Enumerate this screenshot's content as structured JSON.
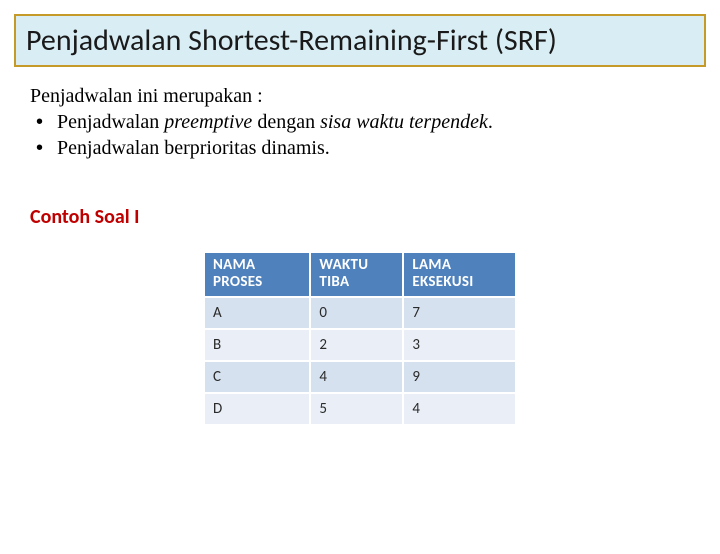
{
  "title": "Penjadwalan Shortest-Remaining-First (SRF)",
  "intro": {
    "lead": "Penjadwalan ini merupakan :",
    "bullets": [
      {
        "prefix": "Penjadwalan ",
        "italic": "preemptive",
        "mid": "  dengan ",
        "italic2": "sisa waktu terpendek",
        "suffix": "."
      },
      {
        "prefix": "Penjadwalan  berprioritas dinamis.",
        "italic": "",
        "mid": "",
        "italic2": "",
        "suffix": ""
      }
    ]
  },
  "subhead": "Contoh Soal I",
  "chart_data": {
    "type": "table",
    "title": "Contoh Soal I",
    "columns": [
      "NAMA PROSES",
      "WAKTU TIBA",
      "LAMA EKSEKUSI"
    ],
    "rows": [
      {
        "nama": "A",
        "waktu_tiba": 0,
        "lama": 7
      },
      {
        "nama": "B",
        "waktu_tiba": 2,
        "lama": 3
      },
      {
        "nama": "C",
        "waktu_tiba": 4,
        "lama": 9
      },
      {
        "nama": "D",
        "waktu_tiba": 5,
        "lama": 4
      }
    ]
  },
  "colors": {
    "title_bg": "#d9edf4",
    "title_border": "#c59a28",
    "th_bg": "#4f81bd",
    "row_odd": "#d6e1ef",
    "row_even": "#eaeff7",
    "subhead": "#c00000"
  }
}
